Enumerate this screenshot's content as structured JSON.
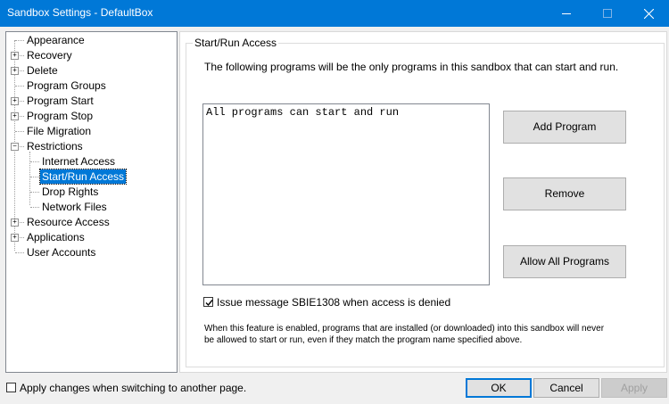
{
  "window": {
    "title": "Sandbox Settings - DefaultBox",
    "controls": [
      "minimize-icon",
      "maximize-icon",
      "close-icon"
    ]
  },
  "tree": {
    "items": [
      {
        "label": "Appearance",
        "level": 0,
        "expander": "none"
      },
      {
        "label": "Recovery",
        "level": 0,
        "expander": "plus"
      },
      {
        "label": "Delete",
        "level": 0,
        "expander": "plus"
      },
      {
        "label": "Program Groups",
        "level": 0,
        "expander": "none"
      },
      {
        "label": "Program Start",
        "level": 0,
        "expander": "plus"
      },
      {
        "label": "Program Stop",
        "level": 0,
        "expander": "plus"
      },
      {
        "label": "File Migration",
        "level": 0,
        "expander": "none"
      },
      {
        "label": "Restrictions",
        "level": 0,
        "expander": "minus"
      },
      {
        "label": "Internet Access",
        "level": 1,
        "expander": "none"
      },
      {
        "label": "Start/Run Access",
        "level": 1,
        "expander": "none",
        "selected": true
      },
      {
        "label": "Drop Rights",
        "level": 1,
        "expander": "none"
      },
      {
        "label": "Network Files",
        "level": 1,
        "expander": "none"
      },
      {
        "label": "Resource Access",
        "level": 0,
        "expander": "plus"
      },
      {
        "label": "Applications",
        "level": 0,
        "expander": "plus"
      },
      {
        "label": "User Accounts",
        "level": 0,
        "expander": "none"
      }
    ]
  },
  "panel": {
    "group_title": "Start/Run Access",
    "description": "The following programs will be the only programs in this sandbox that can start and run.",
    "list_entries": [
      "All programs can start and run"
    ],
    "buttons": {
      "add": "Add Program",
      "remove": "Remove",
      "allow_all": "Allow All Programs"
    },
    "issue_message": {
      "label": "Issue message SBIE1308 when access is denied",
      "checked": true
    },
    "note_line1": "When this feature is enabled, programs that are installed (or downloaded) into this sandbox will never",
    "note_line2": "be allowed to start or run, even if they match the program name specified above."
  },
  "footer": {
    "apply_on_switch": {
      "label": "Apply changes when switching to another page.",
      "checked": false
    },
    "ok": "OK",
    "cancel": "Cancel",
    "apply": "Apply",
    "apply_enabled": false
  },
  "colors": {
    "titlebar": "#0078d7",
    "selection": "#0078d7"
  }
}
